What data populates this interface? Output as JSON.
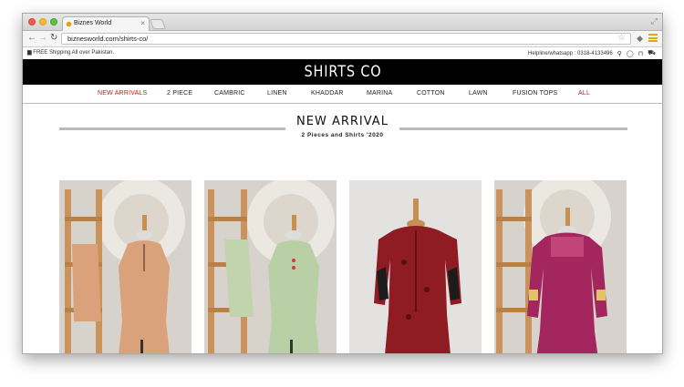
{
  "browser": {
    "tab_title": "Biznes World",
    "url": "biznesworld.com/shirts-co/"
  },
  "topbar": {
    "shipping": "FREE Shipping All over Pakistan.",
    "helpline": "Helpline/whatsapp : 0318-4133496"
  },
  "brand": "SHIRTS CO",
  "nav": [
    {
      "label": "NEW ARRIVALS"
    },
    {
      "label": "2 PIECE"
    },
    {
      "label": "CAMBRIC"
    },
    {
      "label": "LINEN"
    },
    {
      "label": "KHADDAR"
    },
    {
      "label": "MARINA"
    },
    {
      "label": "COTTON"
    },
    {
      "label": "LAWN"
    },
    {
      "label": "FUSION TOPS"
    },
    {
      "label": "ALL"
    }
  ],
  "section": {
    "title": "NEW ARRIVAL",
    "subtitle": "2 Pieces and Shirts '2020"
  },
  "colors": {
    "accent": "#d11414",
    "brand_bg": "#000000",
    "peach_dress": "#d9a27a",
    "mint_dress": "#b9cfa6",
    "red_dress": "#8e1c22",
    "magenta_dress": "#a3265f"
  },
  "icons": [
    "search-icon",
    "user-icon",
    "lock-icon",
    "cart-icon",
    "truck-icon",
    "star-icon",
    "menu-icon"
  ]
}
